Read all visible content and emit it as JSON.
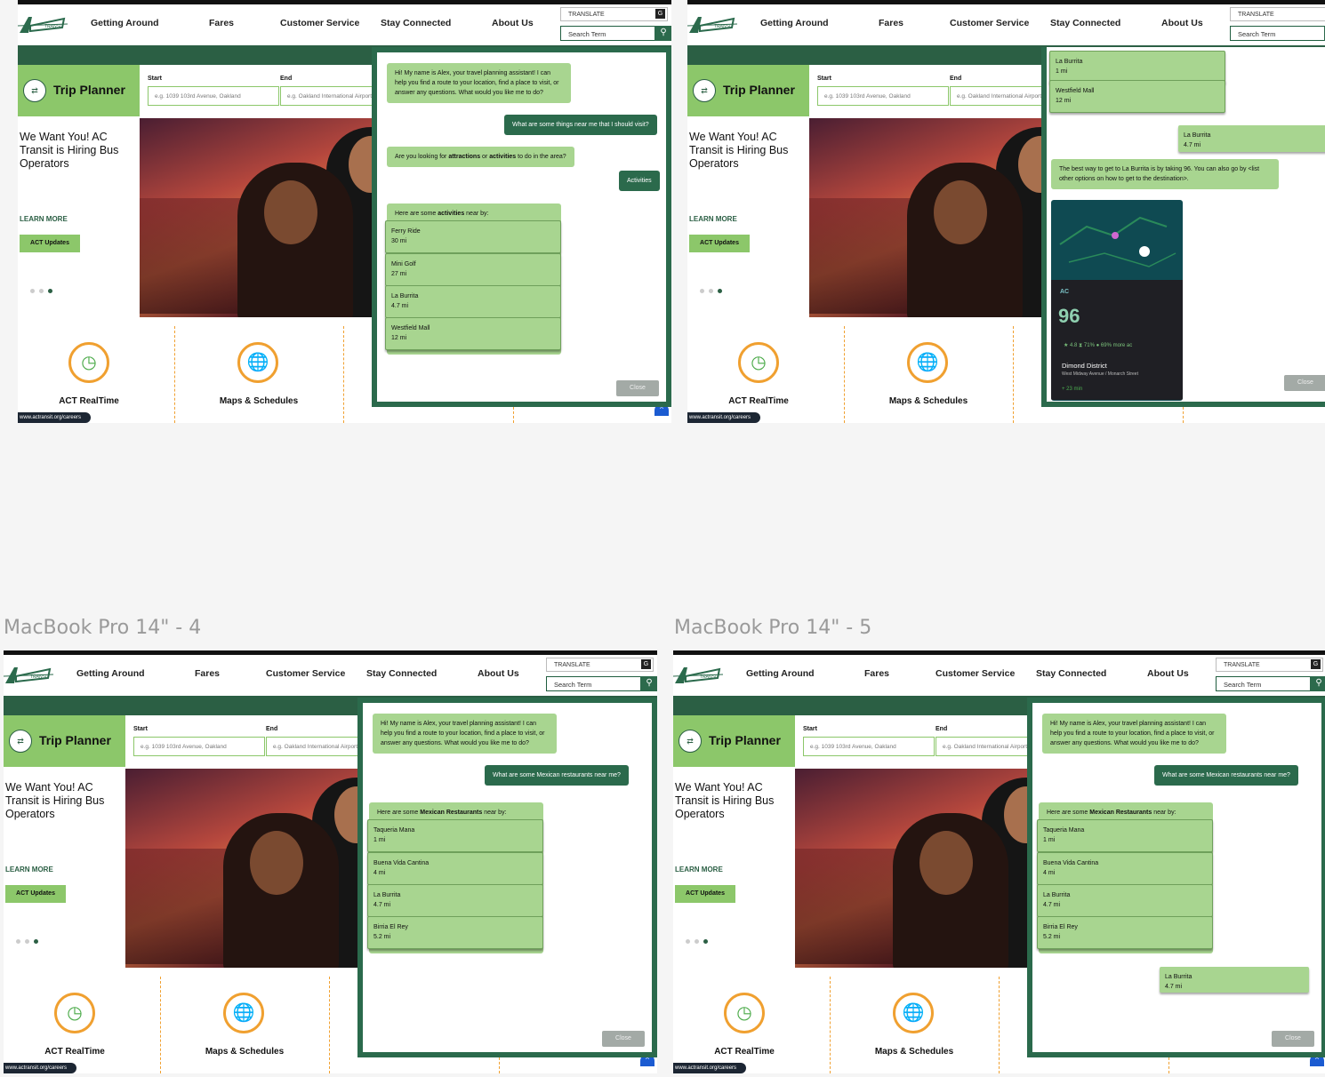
{
  "nav": {
    "logo_text": "TRANSIT",
    "items": [
      "Getting Around",
      "Fares",
      "Customer Service",
      "Stay Connected",
      "About Us"
    ],
    "translate": "TRANSLATE",
    "search_placeholder": "Search Term"
  },
  "trip": {
    "title": "Trip Planner",
    "start_label": "Start",
    "end_label": "End",
    "start_placeholder": "e.g. 1039 103rd Avenue, Oakland",
    "end_placeholder": "e.g. Oakland International Airport"
  },
  "hero": {
    "headline": "We Want You! AC Transit is Hiring Bus Operators",
    "learn_more": "LEARN MORE",
    "updates": "ACT Updates"
  },
  "tiles": [
    "ACT RealTime",
    "Maps & Schedules"
  ],
  "careers_url": "www.actransit.org/careers",
  "frame_labels": [
    "MacBook Pro 14\" - 4",
    "MacBook Pro 14\" - 5"
  ],
  "chat": {
    "greeting": "Hi! My name is Alex, your travel planning assistant! I can help you find a route to your location, find a place to visit, or answer any questions. What would you like me to do?",
    "close": "Close",
    "frame1": {
      "user_q": "What are some things near me that I should visit?",
      "bot_q_pre": "Are you looking for ",
      "bot_q_b1": "attractions",
      "bot_q_mid": " or ",
      "bot_q_b2": "activities",
      "bot_q_post": " to do in the area?",
      "user_a": "Activities",
      "list_pre": "Here are some ",
      "list_bold": "activities",
      "list_post": " near by:",
      "options": [
        {
          "name": "Ferry Ride",
          "dist": "30 mi"
        },
        {
          "name": "Mini Golf",
          "dist": "27 mi"
        },
        {
          "name": "La Burrita",
          "dist": "4.7 mi"
        },
        {
          "name": "Westfield Mall",
          "dist": "12 mi"
        }
      ]
    },
    "frame2": {
      "options": [
        {
          "name": "La Burrita",
          "dist": "1 mi"
        },
        {
          "name": "Westfield Mall",
          "dist": "12 mi"
        }
      ],
      "selected": {
        "name": "La Burrita",
        "dist": "4.7 mi"
      },
      "answer": "The best way to get to La Burrita is by taking 96.  You can also go by <list other options on how to get to the destination>.",
      "map": {
        "route": "96",
        "stats": "★ 4.8    ⧗ 71%    ● 69% more ac",
        "dest": "Dimond District",
        "addr": "West Midway Avenue / Monarch Street",
        "eta": "+ 23 min"
      }
    },
    "frame3": {
      "user_q": "What are some Mexican restaurants near me?",
      "list_pre": "Here are some ",
      "list_bold": "Mexican Restaurants",
      "list_post": " near by:",
      "options": [
        {
          "name": "Taqueria Mana",
          "dist": "1 mi"
        },
        {
          "name": "Buena Vida Cantina",
          "dist": "4 mi"
        },
        {
          "name": "La Burrita",
          "dist": "4.7 mi"
        },
        {
          "name": "Birria El Rey",
          "dist": "5.2 mi"
        }
      ],
      "selected": {
        "name": "La Burrita",
        "dist": "4.7 mi"
      }
    }
  },
  "colors": {
    "dark_green": "#2b6a4c",
    "light_green": "#a8d590",
    "accent": "#f0a030"
  }
}
